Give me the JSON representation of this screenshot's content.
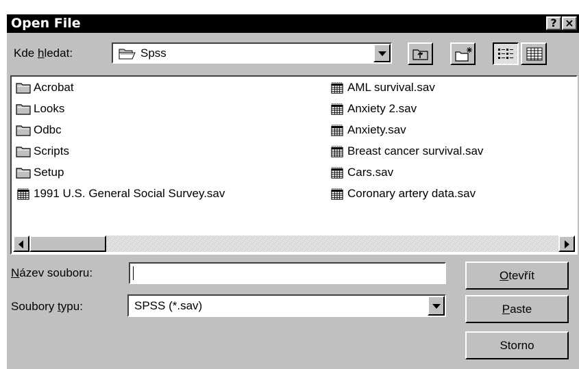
{
  "dialog": {
    "title": "Open File",
    "help_button": "?",
    "close_button": "×"
  },
  "look_in": {
    "label_pre": "Kde ",
    "label_mnemonic": "h",
    "label_post": "ledat:",
    "value": "Spss"
  },
  "files": {
    "left": [
      {
        "name": "Acrobat",
        "icon": "folder-icon"
      },
      {
        "name": "Looks",
        "icon": "folder-icon"
      },
      {
        "name": "Odbc",
        "icon": "folder-icon"
      },
      {
        "name": "Scripts",
        "icon": "folder-icon"
      },
      {
        "name": "Setup",
        "icon": "folder-icon"
      },
      {
        "name": "1991 U.S. General Social Survey.sav",
        "icon": "spss-file-icon"
      }
    ],
    "right": [
      {
        "name": "AML survival.sav",
        "icon": "spss-file-icon"
      },
      {
        "name": "Anxiety 2.sav",
        "icon": "spss-file-icon"
      },
      {
        "name": "Anxiety.sav",
        "icon": "spss-file-icon"
      },
      {
        "name": "Breast cancer survival.sav",
        "icon": "spss-file-icon"
      },
      {
        "name": "Cars.sav",
        "icon": "spss-file-icon"
      },
      {
        "name": "Coronary artery data.sav",
        "icon": "spss-file-icon"
      }
    ]
  },
  "filename": {
    "label_mnemonic": "N",
    "label_post": "ázev souboru:",
    "value": ""
  },
  "filetype": {
    "label_pre": "Soubory ",
    "label_mnemonic": "t",
    "label_post": "ypu:",
    "value": "SPSS (*.sav)"
  },
  "buttons": {
    "open_mnemonic": "O",
    "open_post": "tevřít",
    "paste_mnemonic": "P",
    "paste_post": "aste",
    "cancel": "Storno"
  }
}
